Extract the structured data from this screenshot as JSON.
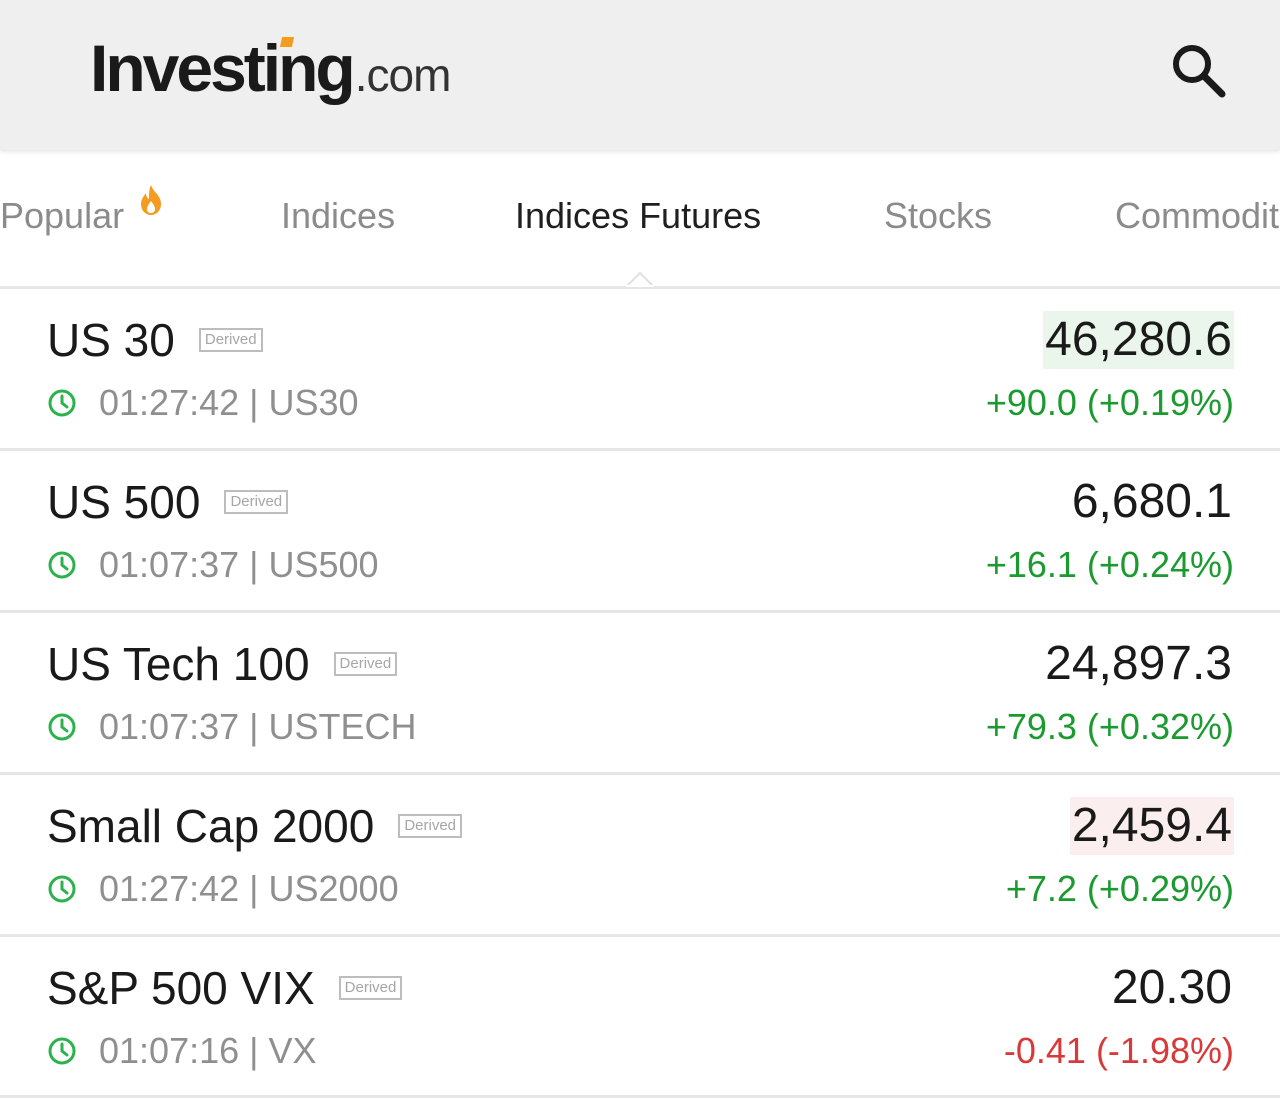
{
  "header": {
    "logo_main": "Investing",
    "logo_suffix": ".com"
  },
  "tabs": [
    {
      "label": "Popular",
      "icon": "flame-icon"
    },
    {
      "label": "Indices"
    },
    {
      "label": "Indices Futures",
      "active": true
    },
    {
      "label": "Stocks"
    },
    {
      "label": "Commodit"
    }
  ],
  "badge_label": "Derived",
  "colors": {
    "positive": "#1a9a2f",
    "negative": "#d83a3a",
    "clock": "#2bb24c",
    "flame": "#f59b1e",
    "logo_accent": "#f59b1e"
  },
  "rows": [
    {
      "name": "US 30",
      "badge": "Derived",
      "meta": "01:27:42 | US30",
      "price": "46,280.6",
      "change": "+90.0 (+0.19%)",
      "direction": "up",
      "price_flash": "up"
    },
    {
      "name": "US 500",
      "badge": "Derived",
      "meta": "01:07:37 | US500",
      "price": "6,680.1",
      "change": "+16.1 (+0.24%)",
      "direction": "up",
      "price_flash": "none"
    },
    {
      "name": "US Tech 100",
      "badge": "Derived",
      "meta": "01:07:37 | USTECH",
      "price": "24,897.3",
      "change": "+79.3 (+0.32%)",
      "direction": "up",
      "price_flash": "none"
    },
    {
      "name": "Small Cap 2000",
      "badge": "Derived",
      "meta": "01:27:42 | US2000",
      "price": "2,459.4",
      "change": "+7.2 (+0.29%)",
      "direction": "up",
      "price_flash": "down"
    },
    {
      "name": "S&P 500 VIX",
      "badge": "Derived",
      "meta": "01:07:16 | VX",
      "price": "20.30",
      "change": "-0.41 (-1.98%)",
      "direction": "down",
      "price_flash": "none"
    }
  ]
}
